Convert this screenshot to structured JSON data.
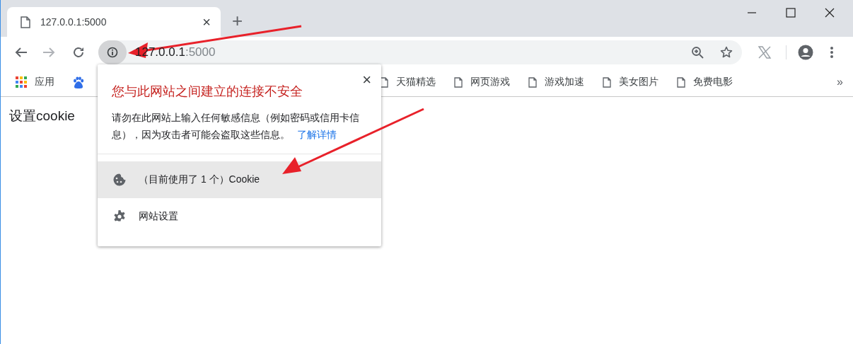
{
  "tab": {
    "title": "127.0.0.1:5000",
    "close": "×"
  },
  "new_tab": "+",
  "address": {
    "host": "127.0.0.1",
    "port": ":5000"
  },
  "bookmarks": [
    {
      "kind": "apps",
      "label": "应用"
    },
    {
      "kind": "baidu"
    },
    {
      "kind": "page",
      "label": "天猫精选"
    },
    {
      "kind": "page",
      "label": "网页游戏"
    },
    {
      "kind": "page",
      "label": "游戏加速"
    },
    {
      "kind": "page",
      "label": "美女图片"
    },
    {
      "kind": "page",
      "label": "免费电影"
    }
  ],
  "overflow": "»",
  "page": {
    "text": "设置cookie"
  },
  "popup": {
    "title": "您与此网站之间建立的连接不安全",
    "close": "×",
    "message": "请勿在此网站上输入任何敏感信息（例如密码或信用卡信息），因为攻击者可能会盗取这些信息。",
    "link": "了解详情",
    "items": [
      {
        "kind": "cookie",
        "label": "（目前使用了 1 个）Cookie",
        "selected": true
      },
      {
        "kind": "settings",
        "label": "网站设置",
        "selected": false
      }
    ]
  }
}
